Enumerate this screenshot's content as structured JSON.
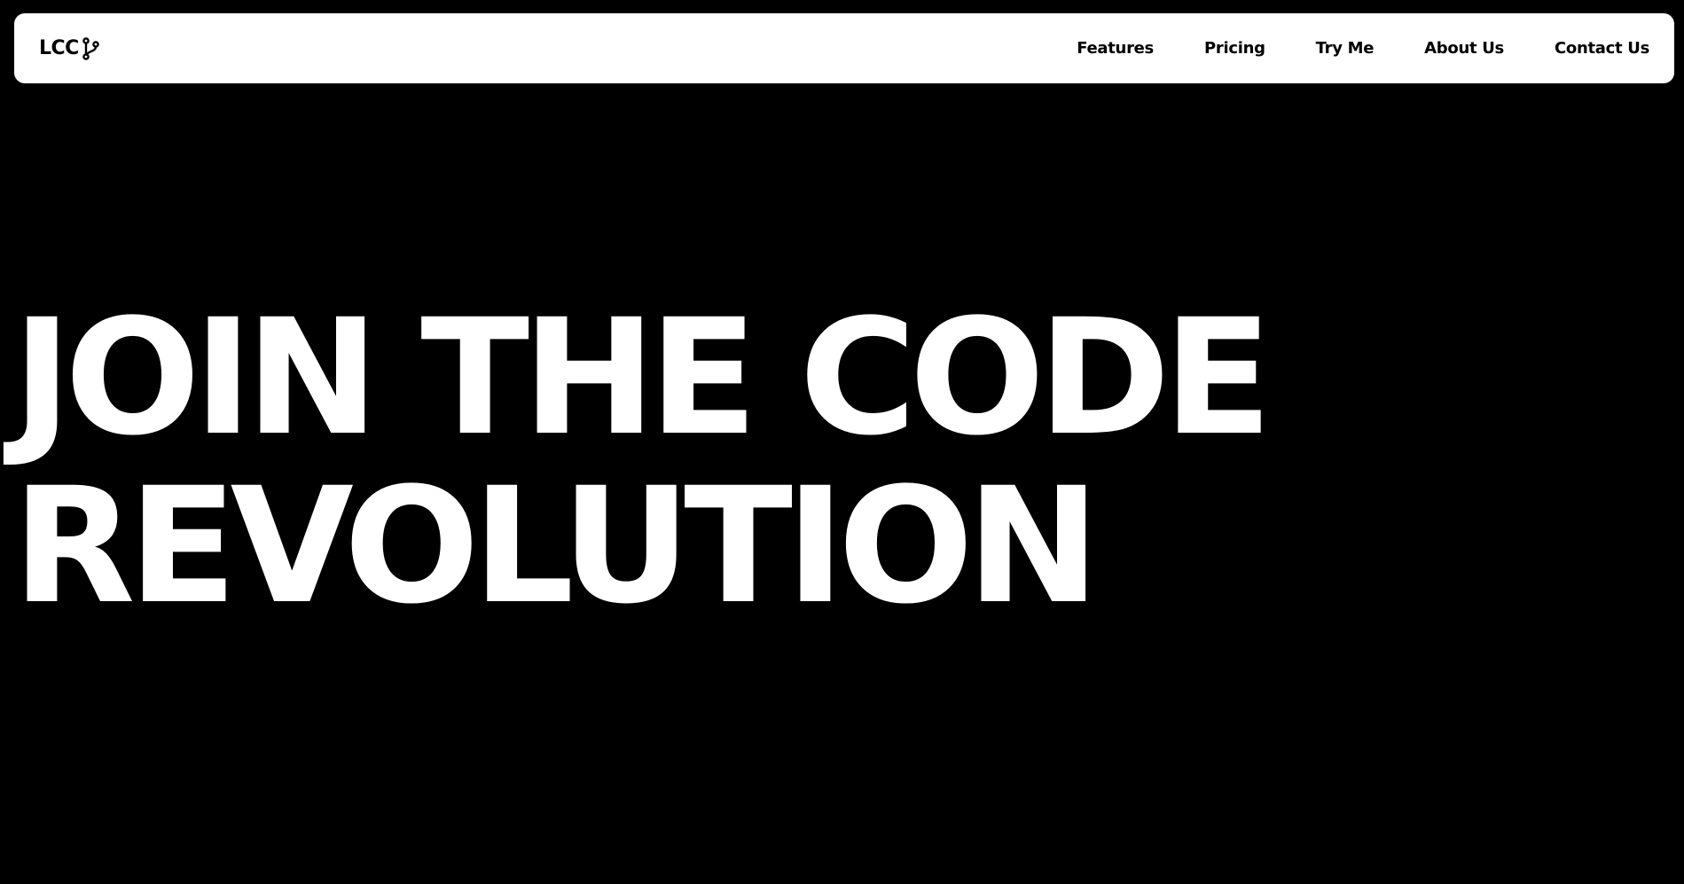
{
  "brand": {
    "name": "LCC",
    "icon": "git-branch-icon"
  },
  "nav": {
    "items": [
      {
        "label": "Features"
      },
      {
        "label": "Pricing"
      },
      {
        "label": "Try Me"
      },
      {
        "label": "About Us"
      },
      {
        "label": "Contact Us"
      }
    ]
  },
  "hero": {
    "line1": "JOIN THE CODE",
    "line2": "REVOLUTION"
  },
  "colors": {
    "background": "#000000",
    "navbar": "#ffffff",
    "text_dark": "#000000",
    "text_light": "#ffffff"
  }
}
